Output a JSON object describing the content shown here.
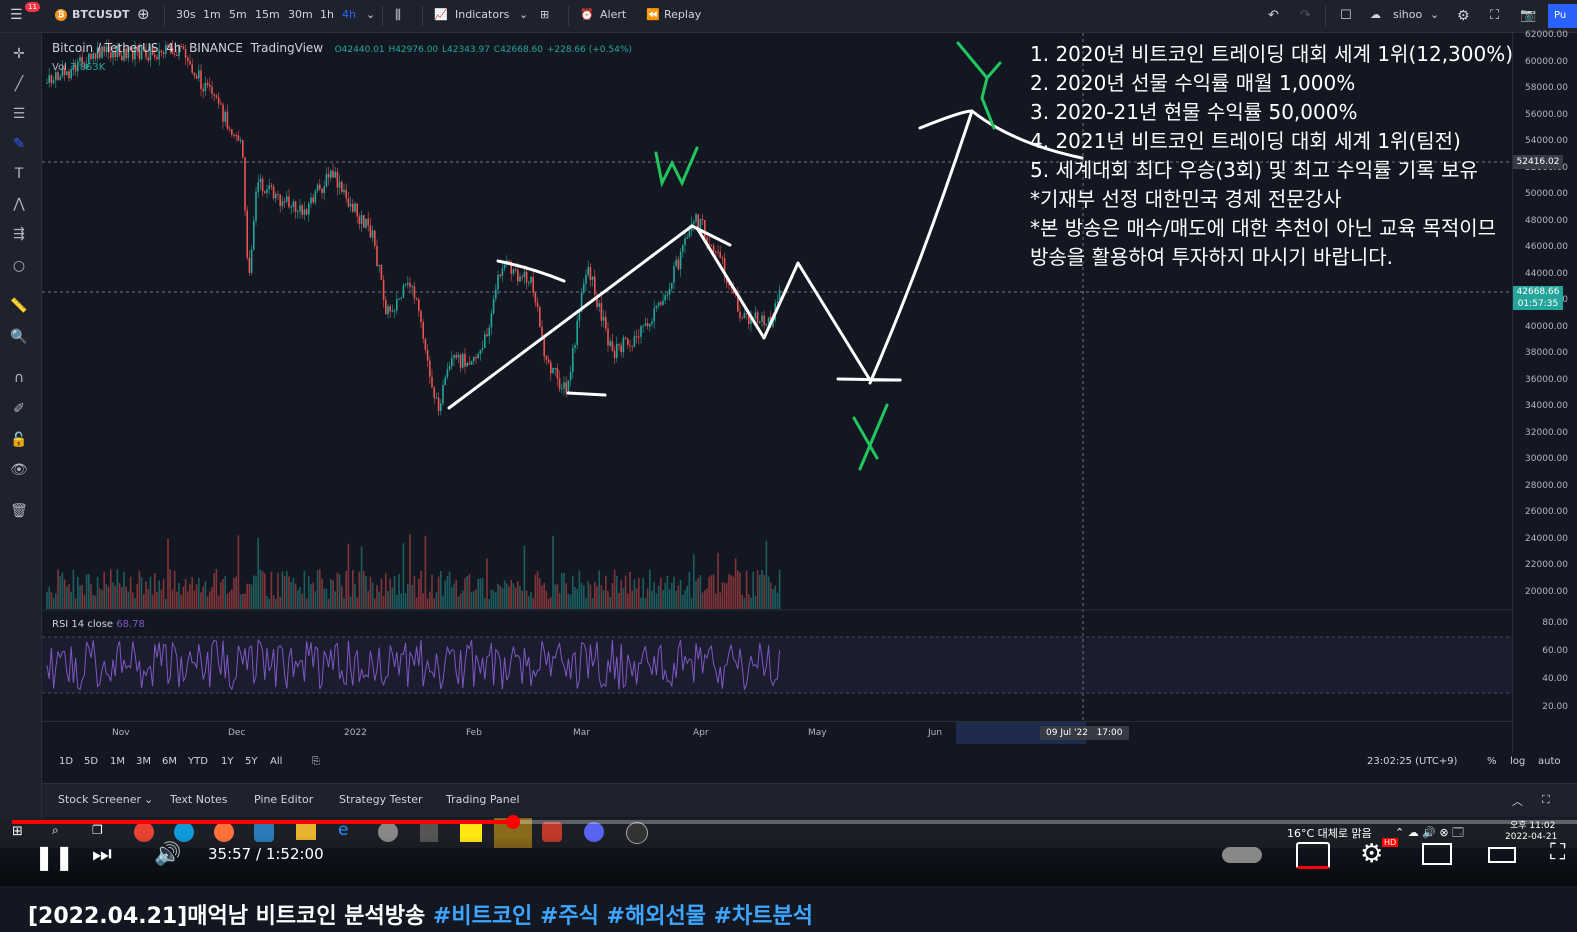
{
  "topbar": {
    "notif_count": "11",
    "symbol": "BTCUSDT",
    "intervals": [
      "30s",
      "1m",
      "5m",
      "15m",
      "30m",
      "1h",
      "4h"
    ],
    "active_interval": "4h",
    "indicators": "Indicators",
    "alert": "Alert",
    "replay": "Replay",
    "layout_name": "sihoo",
    "publish": "Pu"
  },
  "legend": {
    "title": "Bitcoin / TetherUS",
    "interval": "4h",
    "exchange": "BINANCE",
    "source": "TradingView",
    "o": "O42440.01",
    "h": "H42976.00",
    "l": "L42343.97",
    "c": "C42668.60",
    "chg": "+228.66 (+0.54%)",
    "vol_label": "Vol",
    "vol_value": "7.863K"
  },
  "rsi": {
    "label": "RSI 14 close",
    "value": "68.78"
  },
  "price_axis": [
    "62000.00",
    "60000.00",
    "58000.00",
    "56000.00",
    "54000.00",
    "52000.00",
    "50000.00",
    "48000.00",
    "46000.00",
    "44000.00",
    "42000.00",
    "40000.00",
    "38000.00",
    "36000.00",
    "34000.00",
    "32000.00",
    "30000.00",
    "28000.00",
    "26000.00",
    "24000.00",
    "22000.00",
    "20000.00"
  ],
  "rsi_axis": [
    "80.00",
    "60.00",
    "40.00",
    "20.00"
  ],
  "crosshair_price": "52416.02",
  "last_price": "42668.66",
  "countdown": "01:57:35",
  "time_axis": [
    "Nov",
    "Dec",
    "2022",
    "Feb",
    "Mar",
    "Apr",
    "May",
    "Jun"
  ],
  "crosshair_date": "09 Jul '22",
  "crosshair_time": "17:00",
  "range_buttons": [
    "1D",
    "5D",
    "1M",
    "3M",
    "6M",
    "YTD",
    "1Y",
    "5Y",
    "All"
  ],
  "clock": "23:02:25 (UTC+9)",
  "scale_buttons": [
    "%",
    "log",
    "auto"
  ],
  "bottom_tabs": [
    "Stock Screener",
    "Text Notes",
    "Pine Editor",
    "Strategy Tester",
    "Trading Panel"
  ],
  "overlay_notes": [
    "1. 2020년 비트코인 트레이딩 대회 세계 1위(12,300%)",
    "2. 2020년 선물 수익률 매월 1,000%",
    "3. 2020-21년 현물 수익률 50,000%",
    "4. 2021년 비트코인 트레이딩 대회 세계 1위(팀전)",
    "5. 세계대회 최다 우승(3회) 및 최고 수익률 기록 보유",
    "*기재부 선정 대한민국 경제 전문강사",
    "*본 방송은 매수/매도에 대한 추천이 아닌 교육 목적이므",
    " 방송을 활용하여 투자하지 마시기 바랍니다."
  ],
  "annotations": {
    "w": "W",
    "x": "X",
    "y": "Y"
  },
  "taskbar": {
    "weather": "16°C 대체로 맑음",
    "ampm": "오후 11:02",
    "date": "2022-04-21"
  },
  "video": {
    "time": "35:57 / 1:52:00",
    "progress": 0.32,
    "hd": "HD"
  },
  "title": {
    "main": "[2022.04.21]매억남 비트코인 분석방송 ",
    "tags": "#비트코인 #주식 #해외선물 #차트분석"
  },
  "colors": {
    "up": "#26a69a",
    "down": "#ef5350",
    "rsi": "#7e57c2",
    "drawing": "#ffffff",
    "annotation": "#22c55e"
  }
}
